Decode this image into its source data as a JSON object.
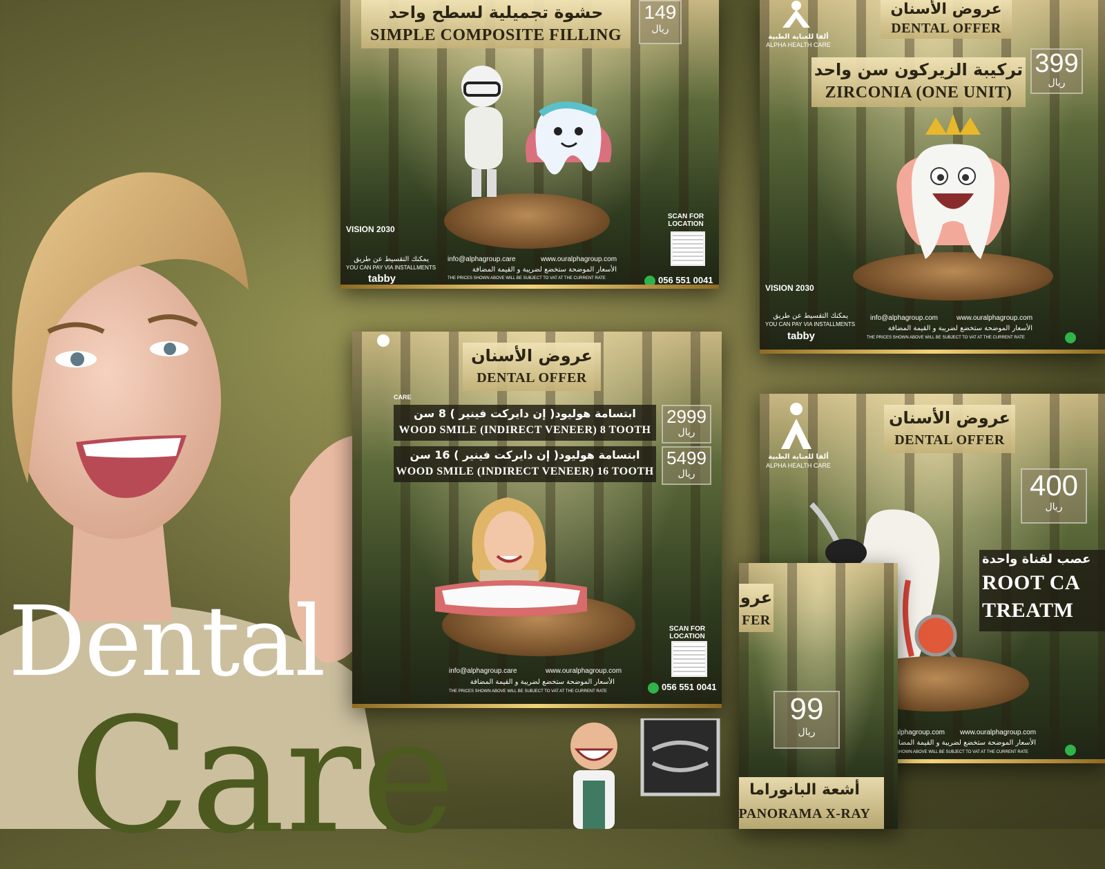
{
  "poster": {
    "headline_1": "Dental",
    "headline_2": "Care"
  },
  "card_filling": {
    "title_ar": "حشوة تجميلية لسطح واحد",
    "title_en": "SIMPLE COMPOSITE FILLING",
    "price": "149",
    "currency": "ريال",
    "scan": "SCAN FOR LOCATION",
    "vision": "VISION 2030",
    "installments_ar": "يمكنك التقسيط عن طريق",
    "installments_en": "YOU CAN PAY VIA INSTALLMENTS",
    "tabby": "tabby",
    "email": "info@alphagroup.care",
    "website": "www.ouralphagroup.com",
    "vat_ar": "الأسعار الموضحة ستخضع لضريبة و القيمة المضافة",
    "vat_en": "THE PRICES SHOWN ABOVE WILL BE SUBJECT TO VAT AT THE CURRENT RATE",
    "phone": "056 551 0041"
  },
  "card_zirconia": {
    "brand_ar": "ألفا للعناية الطبية",
    "brand_en": "ALPHA HEALTH CARE",
    "offer_ar": "عروض الأسنان",
    "offer_en": "DENTAL OFFER",
    "title_ar": "تركيبة الزيركون سن واحد",
    "title_en": "ZIRCONIA (ONE UNIT)",
    "price": "399",
    "currency": "ريال",
    "vision": "VISION 2030",
    "installments_ar": "يمكنك التقسيط عن طريق",
    "installments_en": "YOU CAN PAY VIA INSTALLMENTS",
    "tabby": "tabby",
    "email": "info@alphagroup.com",
    "website": "www.ouralphagroup.com",
    "vat_ar": "الأسعار الموضحة ستخضع لضريبة و القيمة المضافة",
    "vat_en": "THE PRICES SHOWN ABOVE WILL BE SUBJECT TO VAT AT THE CURRENT RATE"
  },
  "card_veneer": {
    "offer_ar": "عروض الأسنان",
    "offer_en": "DENTAL OFFER",
    "brand_partial": "CARE",
    "line1_ar": "ابتسامة هوليود( إن دايركت فينير ) 8 سن",
    "line1_en": "WOOD SMILE (INDIRECT VENEER) 8 TOOTH",
    "line1_price": "2999",
    "line2_ar": "ابتسامة هوليود( إن دايركت فينير ) 16 سن",
    "line2_en": "WOOD SMILE (INDIRECT VENEER) 16 TOOTH",
    "line2_price": "5499",
    "currency": "ريال",
    "scan": "SCAN FOR LOCATION",
    "email": "info@alphagroup.care",
    "website": "www.ouralphagroup.com",
    "vat_ar": "الأسعار الموضحة ستخضع لضريبة و القيمة المضافة",
    "vat_en": "THE PRICES SHOWN ABOVE WILL BE SUBJECT TO VAT AT THE CURRENT RATE",
    "phone": "056 551 0041"
  },
  "card_root": {
    "brand_ar": "ألفا للعناية الطبية",
    "brand_en": "ALPHA HEALTH CARE",
    "offer_ar": "عروض الأسنان",
    "offer_en": "DENTAL OFFER",
    "price": "400",
    "currency": "ريال",
    "title_ar": "عصب لقناة واحدة",
    "title_en_1": "ROOT CA",
    "title_en_2": "TREATM",
    "email": "info@alphagroup.com",
    "website": "www.ouralphagroup.com",
    "vat_ar": "الأسعار الموضحة ستخضع لضريبة و القيمة المضافة",
    "vat_en": "THE PRICES SHOWN ABOVE WILL BE SUBJECT TO VAT AT THE CURRENT RATE"
  },
  "card_panorama": {
    "offer_ar_partial": "عرو",
    "offer_en_partial": "FER",
    "price": "99",
    "currency": "ريال",
    "title_ar": "أشعة البانوراما",
    "title_en": "PANORAMA X-RAY"
  }
}
